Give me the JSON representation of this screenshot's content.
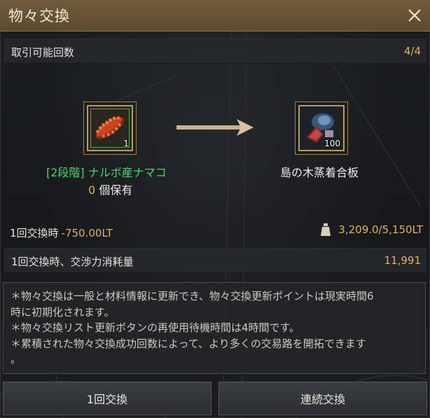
{
  "window": {
    "title": "物々交換",
    "close_icon": "close-icon"
  },
  "trade_count": {
    "label": "取引可能回数",
    "value": "4/4"
  },
  "source_item": {
    "icon": "sea-cucumber-icon",
    "quantity": "1",
    "name": "[2段階] ナルボ産ナマコ",
    "owned_count": "0",
    "owned_suffix": " 個保有"
  },
  "arrow_icon": "right-arrow-icon",
  "target_item": {
    "icon": "plywood-icon",
    "quantity": "100",
    "name": "島の木蒸着合板"
  },
  "per_trade_weight": {
    "label": "1回交換時",
    "value": "-750.00LT"
  },
  "weight_capacity": {
    "icon": "weight-bag-icon",
    "value": "3,209.0/5,150LT"
  },
  "energy_cost": {
    "label": "1回交換時、交渉力消耗量",
    "value": "11,991"
  },
  "description": {
    "lines": [
      "＊物々交換は一般と材料情報に更新でき、物々交換更新ポイントは現実時間6",
      "時に初期化されます。",
      "＊物々交換リスト更新ボタンの再使用待機時間は4時間です。",
      "＊累積された物々交換成功回数によって、より多くの交易路を開拓できます",
      "。"
    ]
  },
  "buttons": {
    "single": "1回交換",
    "continuous": "連続交換"
  }
}
